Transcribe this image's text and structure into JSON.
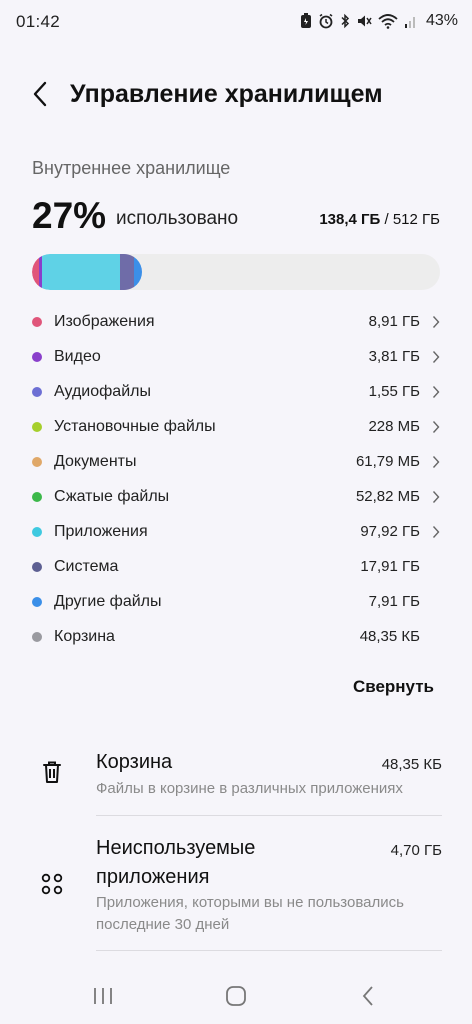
{
  "status": {
    "time": "01:42",
    "battery": "43%",
    "icons": [
      "battery-saver-icon",
      "alarm-icon",
      "bluetooth-icon",
      "mute-icon",
      "wifi-icon",
      "signal-icon"
    ]
  },
  "header": {
    "title": "Управление хранилищем"
  },
  "storage": {
    "section_label": "Внутреннее хранилище",
    "percent": "27%",
    "percent_word": "использовано",
    "used": "138,4 ГБ",
    "separator": " / ",
    "total": "512 ГБ",
    "used_fraction": 0.27
  },
  "categories": [
    {
      "name": "Изображения",
      "size": "8,91 ГБ",
      "color": "#e0557a",
      "chevron": true
    },
    {
      "name": "Видео",
      "size": "3,81 ГБ",
      "color": "#8a3fcb",
      "chevron": true
    },
    {
      "name": "Аудиофайлы",
      "size": "1,55 ГБ",
      "color": "#6d6fd4",
      "chevron": true
    },
    {
      "name": "Установочные файлы",
      "size": "228 МБ",
      "color": "#a6cf2c",
      "chevron": true
    },
    {
      "name": "Документы",
      "size": "61,79 МБ",
      "color": "#e0a868",
      "chevron": true
    },
    {
      "name": "Сжатые файлы",
      "size": "52,82 МБ",
      "color": "#3cb84a",
      "chevron": true
    },
    {
      "name": "Приложения",
      "size": "97,92 ГБ",
      "color": "#3fc9e0",
      "chevron": true
    },
    {
      "name": "Система",
      "size": "17,91 ГБ",
      "color": "#5d5f92",
      "chevron": false
    },
    {
      "name": "Другие файлы",
      "size": "7,91 ГБ",
      "color": "#3b8fe8",
      "chevron": false
    },
    {
      "name": "Корзина",
      "size": "48,35 КБ",
      "color": "#9a9aa0",
      "chevron": false
    }
  ],
  "collapse_label": "Свернуть",
  "suggestions": [
    {
      "title": "Корзина",
      "size": "48,35 КБ",
      "subtitle": "Файлы в корзине в различных приложениях",
      "icon": "trash-icon"
    },
    {
      "title_line1": "Неиспользуемые",
      "title_line2": "приложения",
      "size": "4,70 ГБ",
      "subtitle_line1": "Приложения, которыми вы не пользовались",
      "subtitle_line2": "последние 30 дней",
      "icon": "apps-grid-icon"
    }
  ],
  "nav": [
    "recents-icon",
    "home-icon",
    "back-icon"
  ]
}
